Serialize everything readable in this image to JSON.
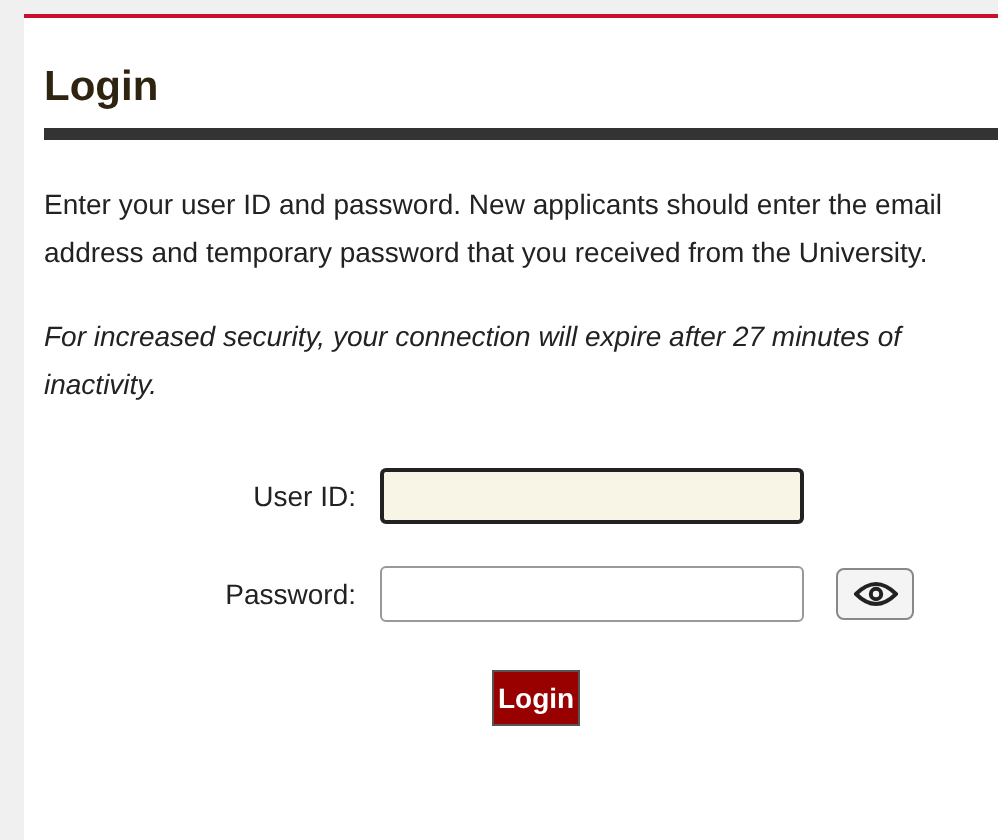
{
  "page": {
    "title": "Login"
  },
  "instructions": "Enter your user ID and password. New applicants should enter the email address and temporary password that you received from the University.",
  "security_note": "For increased security, your connection will expire after 27 minutes of inactivity.",
  "fields": [
    {
      "kind": "text",
      "label": "User ID:",
      "focused": true
    },
    {
      "kind": "password",
      "label": "Password:",
      "focused": false
    }
  ],
  "submit": {
    "label": "Login"
  }
}
